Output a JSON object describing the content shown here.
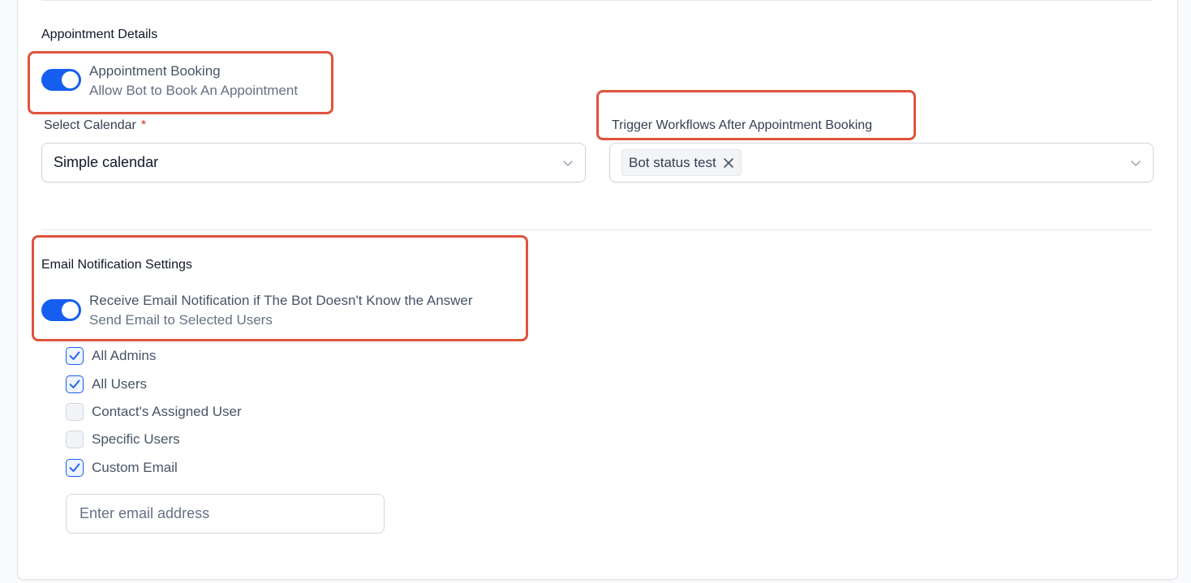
{
  "appointment": {
    "section_title": "Appointment Details",
    "booking_toggle": {
      "title": "Appointment Booking",
      "description": "Allow Bot to Book An Appointment",
      "enabled": true
    },
    "calendar": {
      "label": "Select Calendar",
      "required_mark": "*",
      "value": "Simple calendar",
      "chevron_icon": "chevron-down-icon"
    },
    "workflows": {
      "label": "Trigger Workflows After Appointment Booking",
      "tags": [
        "Bot status test"
      ],
      "remove_icon": "close-icon",
      "chevron_icon": "chevron-down-icon"
    }
  },
  "email_notifications": {
    "section_title": "Email Notification Settings",
    "toggle": {
      "title": "Receive Email Notification if The Bot Doesn't Know the Answer",
      "description": "Send Email to Selected Users",
      "enabled": true
    },
    "recipients": [
      {
        "label": "All Admins",
        "checked": true
      },
      {
        "label": "All Users",
        "checked": true
      },
      {
        "label": "Contact's Assigned User",
        "checked": false
      },
      {
        "label": "Specific Users",
        "checked": false
      },
      {
        "label": "Custom Email",
        "checked": true
      }
    ],
    "email_input": {
      "placeholder": "Enter email address",
      "value": ""
    }
  },
  "colors": {
    "primary": "#155eef",
    "highlight": "#e0533d",
    "required": "#d92d20"
  }
}
